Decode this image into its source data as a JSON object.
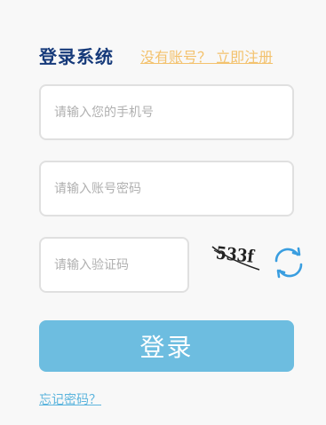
{
  "header": {
    "title": "登录系统",
    "register_link": "没有账号？ 立即注册"
  },
  "form": {
    "phone_placeholder": "请输入您的手机号",
    "password_placeholder": "请输入账号密码",
    "captcha_placeholder": "请输入验证码",
    "captcha_text": "533f",
    "refresh_icon": "refresh-icon",
    "login_label": "登录",
    "forgot_link": "忘记密码？"
  },
  "colors": {
    "title": "#163a7a",
    "register_link": "#f3c26e",
    "login_button": "#6dbde0",
    "forgot_link": "#5bb4dd",
    "refresh_icon": "#3a9ee0",
    "background": "#f8f8f8"
  }
}
